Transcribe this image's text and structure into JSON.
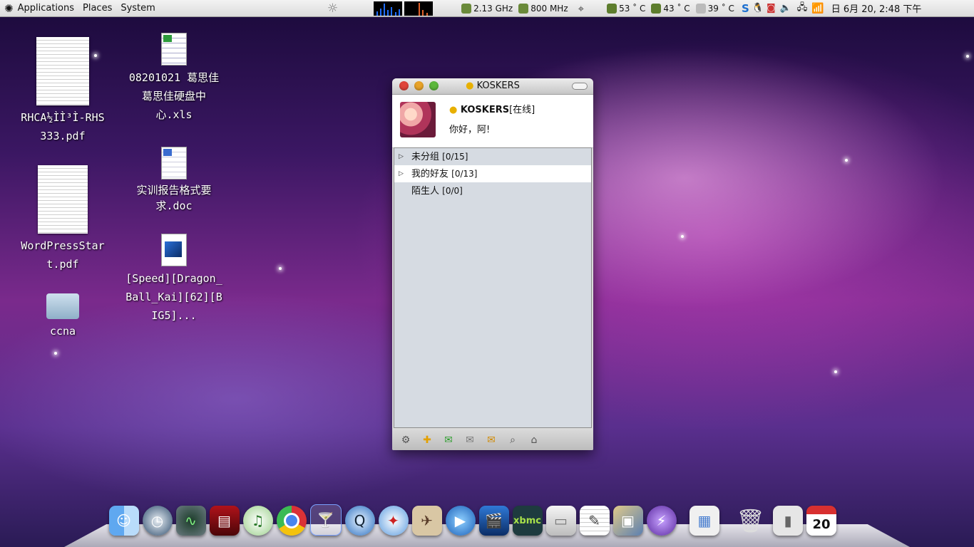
{
  "top_panel": {
    "menus": [
      "Applications",
      "Places",
      "System"
    ],
    "cpu_freq_1": "2.13 GHz",
    "cpu_freq_2": "800 MHz",
    "temps": [
      "53 ˚ C",
      "43 ˚ C",
      "39 ˚ C"
    ],
    "clock": "日  6月 20,  2:48 下午"
  },
  "desktop": {
    "icons": [
      {
        "label": "RHCA½ÌÌ³Ì-RHS333.pdf"
      },
      {
        "label": "WordPressStart.pdf"
      },
      {
        "label": "ccna"
      },
      {
        "label": "08201021 葛思佳 葛思佳硬盘中心.xls"
      },
      {
        "label": "实训报告格式要求.doc"
      },
      {
        "label": "[Speed][Dragon_Ball_Kai][62][BIG5]..."
      }
    ]
  },
  "qq_window": {
    "title": "KOSKERS",
    "nickname": "KOSKERS",
    "status": "[在线]",
    "signature": "你好，阿!",
    "groups": [
      {
        "name": "未分组",
        "count": "[0/15]",
        "selected": false,
        "expandable": true
      },
      {
        "name": "我的好友",
        "count": "[0/13]",
        "selected": true,
        "expandable": true
      },
      {
        "name": "陌生人",
        "count": "[0/0]",
        "selected": false,
        "expandable": false
      }
    ]
  },
  "dock": {
    "calendar_day": "20"
  }
}
